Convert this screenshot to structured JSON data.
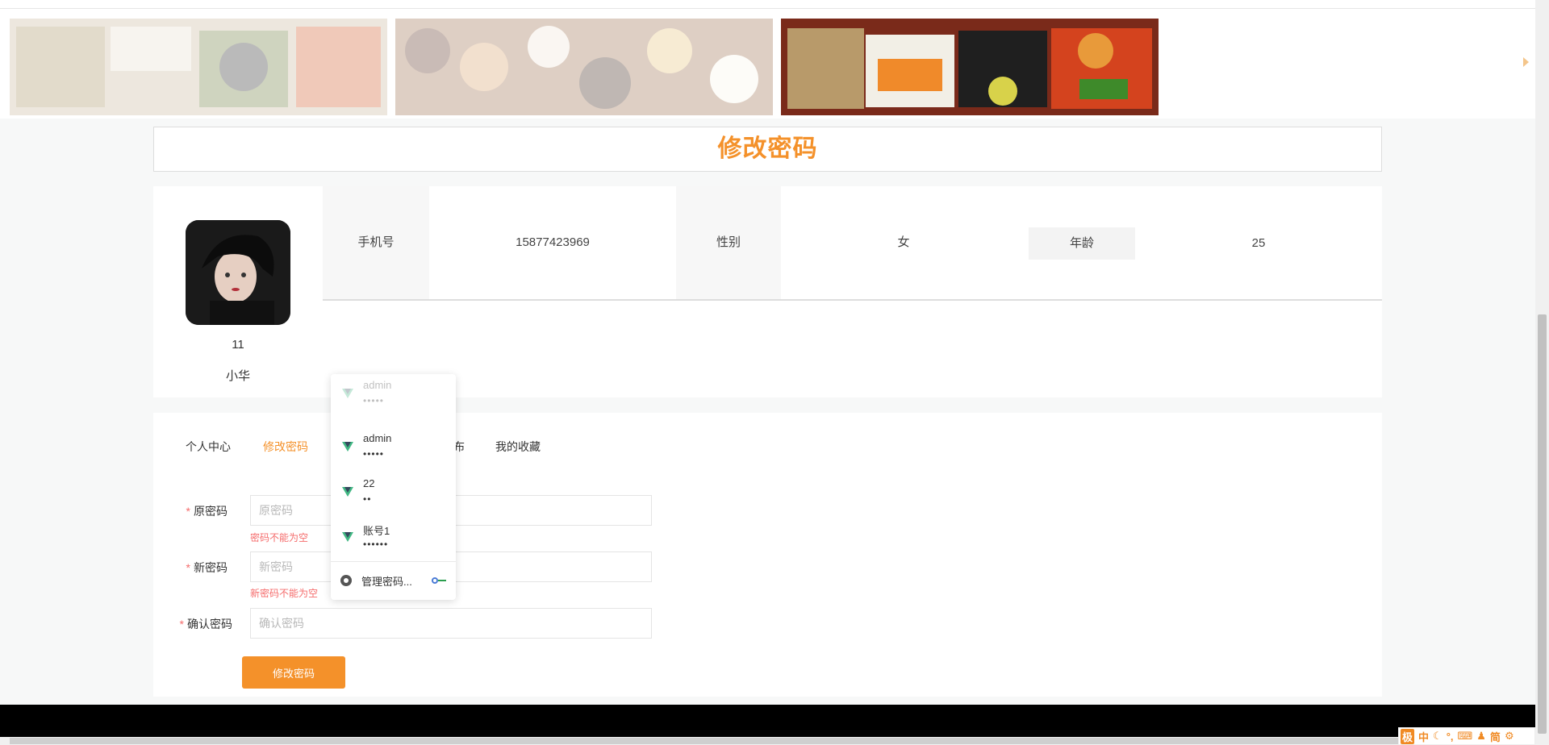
{
  "page_title": "修改密码",
  "profile": {
    "user_id": "11",
    "username": "小华",
    "phone_label": "手机号",
    "phone_value": "15877423969",
    "gender_label": "性别",
    "gender_value": "女",
    "age_label": "年龄",
    "age_value": "25"
  },
  "tabs": [
    {
      "label": "个人中心",
      "active": false
    },
    {
      "label": "修改密码",
      "active": true
    },
    {
      "label": "我的发布",
      "active": false
    },
    {
      "label": "我的收藏",
      "active": false
    }
  ],
  "form": {
    "old_password": {
      "label": "原密码",
      "placeholder": "原密码",
      "error": "密码不能为空"
    },
    "new_password": {
      "label": "新密码",
      "placeholder": "新密码",
      "error": "新密码不能为空"
    },
    "confirm_password": {
      "label": "确认密码",
      "placeholder": "确认密码"
    },
    "required_mark": "*",
    "submit_label": "修改密码"
  },
  "autofill": {
    "entries": [
      {
        "username": "admin",
        "password": "•••••"
      },
      {
        "username": "22",
        "password": "••"
      },
      {
        "username": "账号1",
        "password": "••••••"
      }
    ],
    "manage_label": "管理密码..."
  },
  "ime_bar": {
    "logo": "极",
    "items": [
      "中",
      "简"
    ]
  },
  "colors": {
    "accent": "#f4912a",
    "error": "#f56c6c",
    "footer": "#000000"
  }
}
